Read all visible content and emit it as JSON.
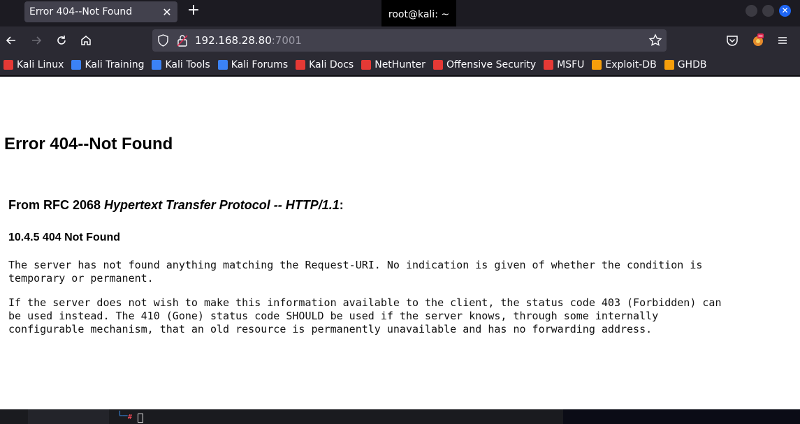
{
  "tab": {
    "title": "Error 404--Not Found",
    "close": "✕",
    "new_tab": "+"
  },
  "terminal": {
    "title": "root@kali: ~"
  },
  "window": {
    "close": "✕"
  },
  "nav": {
    "url_host": "192.168.28.80",
    "url_port": ":7001"
  },
  "bookmarks": [
    {
      "label": "Kali Linux",
      "icon": "kali-icon",
      "color": "#e53935"
    },
    {
      "label": "Kali Training",
      "icon": "kali-training-icon",
      "color": "#3b82f6"
    },
    {
      "label": "Kali Tools",
      "icon": "kali-tools-icon",
      "color": "#3b82f6"
    },
    {
      "label": "Kali Forums",
      "icon": "kali-forums-icon",
      "color": "#3b82f6"
    },
    {
      "label": "Kali Docs",
      "icon": "kali-docs-icon",
      "color": "#e53935"
    },
    {
      "label": "NetHunter",
      "icon": "nethunter-icon",
      "color": "#e53935"
    },
    {
      "label": "Offensive Security",
      "icon": "offsec-icon",
      "color": "#e53935"
    },
    {
      "label": "MSFU",
      "icon": "msfu-icon",
      "color": "#e53935"
    },
    {
      "label": "Exploit-DB",
      "icon": "exploitdb-icon",
      "color": "#f59e0b"
    },
    {
      "label": "GHDB",
      "icon": "ghdb-icon",
      "color": "#f59e0b"
    }
  ],
  "page": {
    "heading": "Error 404--Not Found",
    "rfc_prefix": "From RFC 2068 ",
    "rfc_title": "Hypertext Transfer Protocol -- HTTP/1.1",
    "rfc_suffix": ":",
    "section": "10.4.5 404 Not Found",
    "para1": "The server has not found anything matching the Request-URI. No indication is given of whether the condition is\ntemporary or permanent.",
    "para2": "If the server does not wish to make this information available to the client, the status code 403 (Forbidden) can\nbe used instead. The 410 (Gone) status code SHOULD be used if the server knows, through some internally\nconfigurable mechanism, that an old resource is permanently unavailable and has no forwarding address."
  },
  "taskbar": {
    "prompt": "└─",
    "hash": "#"
  },
  "colors": {
    "accent": "#1e66f5",
    "chrome_bg": "#2b2a33",
    "tab_bg": "#42414d"
  }
}
